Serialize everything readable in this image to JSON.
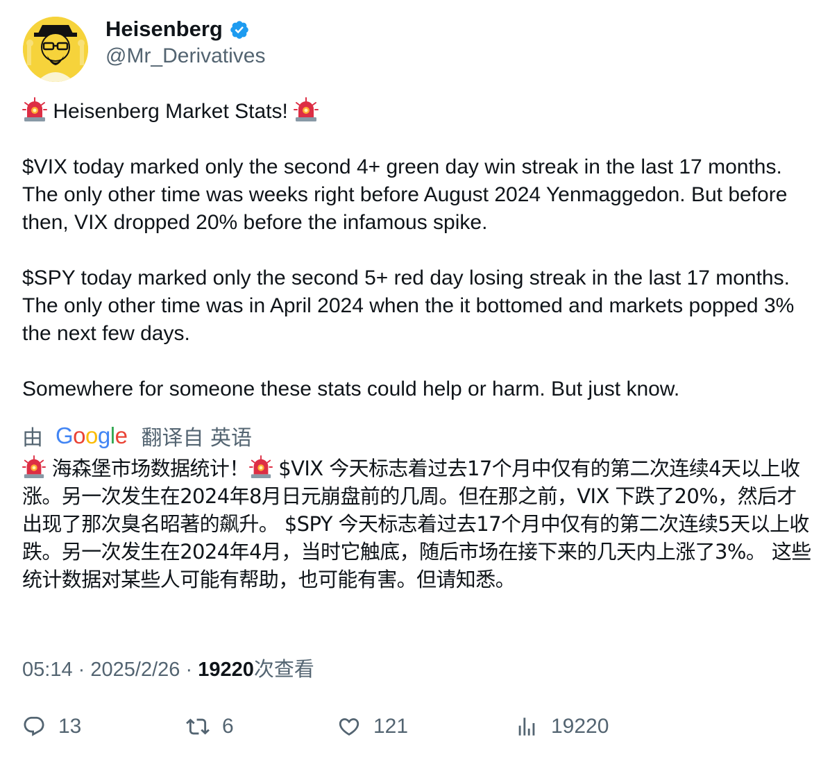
{
  "author": {
    "display_name": "Heisenberg",
    "handle": "@Mr_Derivatives",
    "verified": true,
    "verified_color": "#1d9bf0",
    "avatar_bg": "#f6d33b"
  },
  "tweet": {
    "heading": "Heisenberg Market Stats!",
    "paragraphs": [
      "$VIX today marked only the second 4+ green day win streak in the last 17 months. The only other time was weeks right before August 2024 Yenmaggedon. But before then, VIX dropped 20% before the infamous spike.",
      "$SPY today marked only the second 5+ red day losing streak in the last 17 months. The only other time was in April 2024 when the it bottomed and markets popped 3% the next few days.",
      "Somewhere for someone these stats could help or harm. But just know."
    ],
    "emoji": "siren-icon"
  },
  "translation": {
    "prefix": "由",
    "provider": "Google",
    "suffix": "翻译自 英语",
    "heading": "海森堡市场数据统计！",
    "body": "$VIX 今天标志着过去17个月中仅有的第二次连续4天以上收涨。另一次发生在2024年8月日元崩盘前的几周。但在那之前，VIX 下跌了20%，然后才出现了那次臭名昭著的飙升。 $SPY 今天标志着过去17个月中仅有的第二次连续5天以上收跌。另一次发生在2024年4月，当时它触底，随后市场在接下来的几天内上涨了3%。 这些统计数据对某些人可能有帮助，也可能有害。但请知悉。"
  },
  "meta": {
    "time": "05:14",
    "separator": "·",
    "date": "2025/2/26",
    "views_count": "19220",
    "views_label": "次查看"
  },
  "actions": {
    "replies": "13",
    "retweets": "6",
    "likes": "121",
    "views": "19220"
  }
}
